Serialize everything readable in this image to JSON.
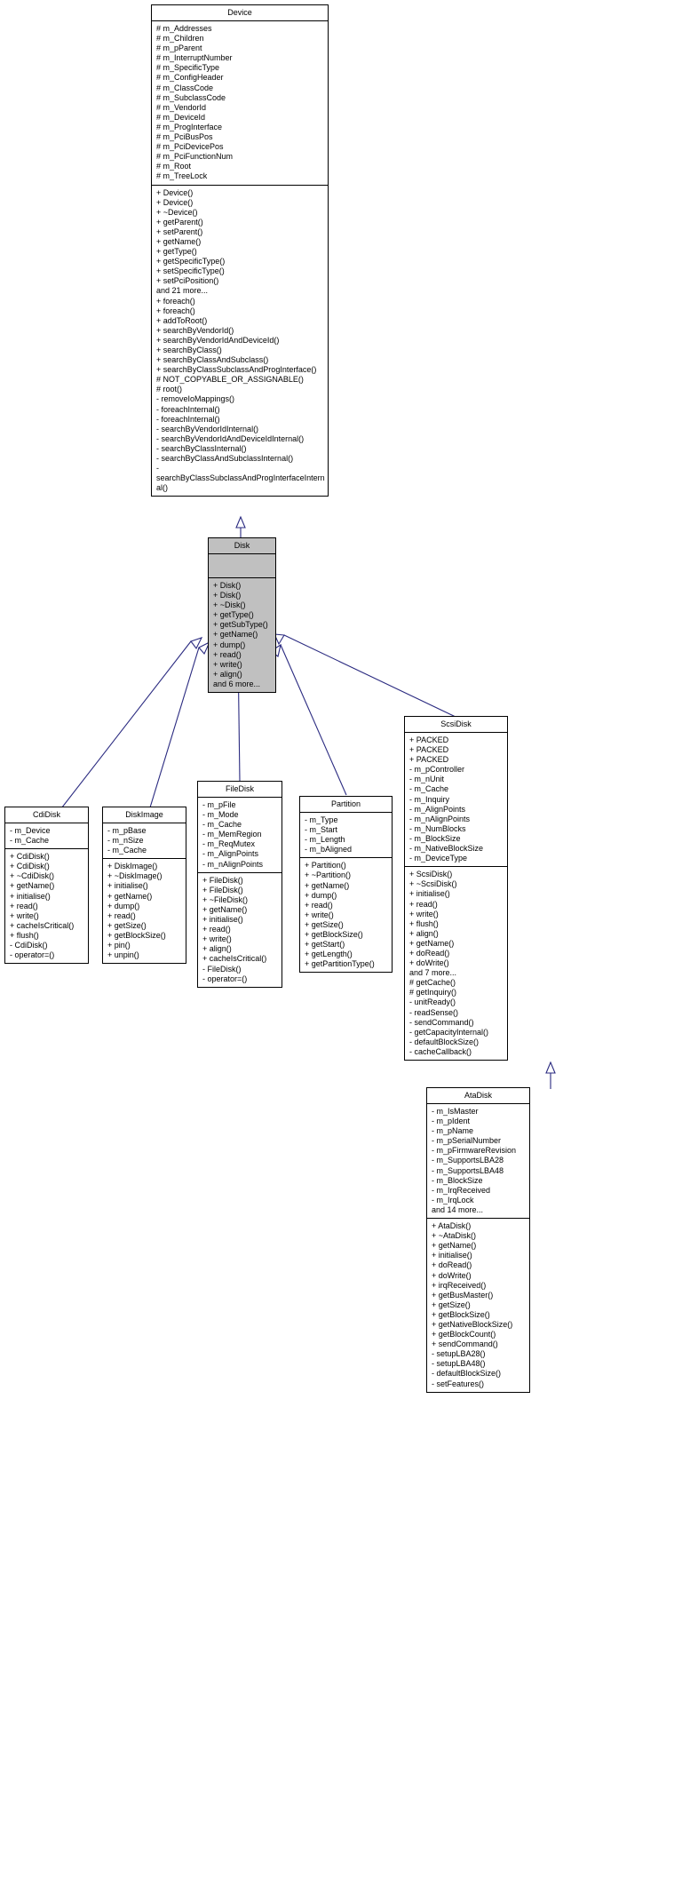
{
  "diagram": {
    "kind": "uml-inheritance-diagram",
    "edge_color": "#2a2a80",
    "highlight_fill": "#c0c0c0",
    "box_border": "#000000",
    "background": "#ffffff"
  },
  "classes": {
    "device": {
      "name": "Device",
      "attributes": [
        "# m_Addresses",
        "# m_Children",
        "# m_pParent",
        "# m_InterruptNumber",
        "# m_SpecificType",
        "# m_ConfigHeader",
        "# m_ClassCode",
        "# m_SubclassCode",
        "# m_VendorId",
        "# m_DeviceId",
        "# m_ProgInterface",
        "# m_PciBusPos",
        "# m_PciDevicePos",
        "# m_PciFunctionNum",
        "# m_Root",
        "# m_TreeLock"
      ],
      "methods": [
        "+ Device()",
        "+ Device()",
        "+ ~Device()",
        "+ getParent()",
        "+ setParent()",
        "+ getName()",
        "+ getType()",
        "+ getSpecificType()",
        "+ setSpecificType()",
        "+ setPciPosition()",
        "and 21 more...",
        "+ foreach()",
        "+ foreach()",
        "+ addToRoot()",
        "+ searchByVendorId()",
        "+ searchByVendorIdAndDeviceId()",
        "+ searchByClass()",
        "+ searchByClassAndSubclass()",
        "+ searchByClassSubclassAndProgInterface()",
        "# NOT_COPYABLE_OR_ASSIGNABLE()",
        "# root()",
        "- removeIoMappings()",
        "- foreachInternal()",
        "- foreachInternal()",
        "- searchByVendorIdInternal()",
        "- searchByVendorIdAndDeviceIdInternal()",
        "- searchByClassInternal()",
        "- searchByClassAndSubclassInternal()",
        "- searchByClassSubclassAndProgInterfaceInternal()"
      ]
    },
    "disk": {
      "name": "Disk",
      "attributes": [],
      "methods": [
        "+ Disk()",
        "+ Disk()",
        "+ ~Disk()",
        "+ getType()",
        "+ getSubType()",
        "+ getName()",
        "+ dump()",
        "+ read()",
        "+ write()",
        "+ align()",
        "and 6 more..."
      ]
    },
    "cdidisk": {
      "name": "CdiDisk",
      "attributes": [
        "- m_Device",
        "- m_Cache"
      ],
      "methods": [
        "+ CdiDisk()",
        "+ CdiDisk()",
        "+ ~CdiDisk()",
        "+ getName()",
        "+ initialise()",
        "+ read()",
        "+ write()",
        "+ cacheIsCritical()",
        "+ flush()",
        "- CdiDisk()",
        "- operator=()"
      ]
    },
    "diskimage": {
      "name": "DiskImage",
      "attributes": [
        "- m_pBase",
        "- m_nSize",
        "- m_Cache"
      ],
      "methods": [
        "+ DiskImage()",
        "+ ~DiskImage()",
        "+ initialise()",
        "+ getName()",
        "+ dump()",
        "+ read()",
        "+ getSize()",
        "+ getBlockSize()",
        "+ pin()",
        "+ unpin()"
      ]
    },
    "filedisk": {
      "name": "FileDisk",
      "attributes": [
        "- m_pFile",
        "- m_Mode",
        "- m_Cache",
        "- m_MemRegion",
        "- m_ReqMutex",
        "- m_AlignPoints",
        "- m_nAlignPoints"
      ],
      "methods": [
        "+ FileDisk()",
        "+ FileDisk()",
        "+ ~FileDisk()",
        "+ getName()",
        "+ initialise()",
        "+ read()",
        "+ write()",
        "+ align()",
        "+ cacheIsCritical()",
        "- FileDisk()",
        "- operator=()"
      ]
    },
    "partition": {
      "name": "Partition",
      "attributes": [
        "- m_Type",
        "- m_Start",
        "- m_Length",
        "- m_bAligned"
      ],
      "methods": [
        "+ Partition()",
        "+ ~Partition()",
        "+ getName()",
        "+ dump()",
        "+ read()",
        "+ write()",
        "+ getSize()",
        "+ getBlockSize()",
        "+ getStart()",
        "+ getLength()",
        "+ getPartitionType()"
      ]
    },
    "scsidisk": {
      "name": "ScsiDisk",
      "attributes": [
        "+ PACKED",
        "+ PACKED",
        "+ PACKED",
        "- m_pController",
        "- m_nUnit",
        "- m_Cache",
        "- m_Inquiry",
        "- m_AlignPoints",
        "- m_nAlignPoints",
        "- m_NumBlocks",
        "- m_BlockSize",
        "- m_NativeBlockSize",
        "- m_DeviceType"
      ],
      "methods": [
        "+ ScsiDisk()",
        "+ ~ScsiDisk()",
        "+ initialise()",
        "+ read()",
        "+ write()",
        "+ flush()",
        "+ align()",
        "+ getName()",
        "+ doRead()",
        "+ doWrite()",
        "and 7 more...",
        "# getCache()",
        "# getInquiry()",
        "- unitReady()",
        "- readSense()",
        "- sendCommand()",
        "- getCapacityInternal()",
        "- defaultBlockSize()",
        "- cacheCallback()"
      ]
    },
    "atadisk": {
      "name": "AtaDisk",
      "attributes": [
        "- m_IsMaster",
        "- m_pIdent",
        "- m_pName",
        "- m_pSerialNumber",
        "- m_pFirmwareRevision",
        "- m_SupportsLBA28",
        "- m_SupportsLBA48",
        "- m_BlockSize",
        "- m_IrqReceived",
        "- m_IrqLock",
        "and 14 more..."
      ],
      "methods": [
        "+ AtaDisk()",
        "+ ~AtaDisk()",
        "+ getName()",
        "+ initialise()",
        "+ doRead()",
        "+ doWrite()",
        "+ irqReceived()",
        "+ getBusMaster()",
        "+ getSize()",
        "+ getBlockSize()",
        "+ getNativeBlockSize()",
        "+ getBlockCount()",
        "+ sendCommand()",
        "- setupLBA28()",
        "- setupLBA48()",
        "- defaultBlockSize()",
        "- setFeatures()"
      ]
    }
  }
}
